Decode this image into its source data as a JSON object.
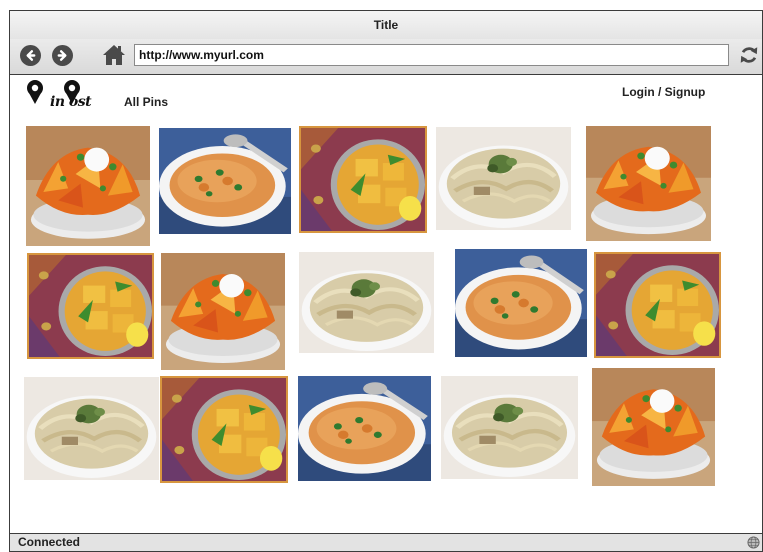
{
  "window": {
    "title": "Title"
  },
  "toolbar": {
    "url": "http://www.myurl.com",
    "back_icon": "arrow-left-circle-icon",
    "forward_icon": "arrow-right-circle-icon",
    "home_icon": "home-icon",
    "reload_icon": "refresh-icon"
  },
  "header": {
    "logo_text": "in ost",
    "all_pins": "All Pins",
    "login": "Login / Signup"
  },
  "pins": [
    {
      "dish": "curry-nachos",
      "framed": false
    },
    {
      "dish": "soup-bowl",
      "framed": false
    },
    {
      "dish": "tofu-curry",
      "framed": true
    },
    {
      "dish": "pasta",
      "framed": false
    },
    {
      "dish": "curry-nachos",
      "framed": false
    },
    {
      "dish": "tofu-curry",
      "framed": true
    },
    {
      "dish": "curry-nachos",
      "framed": false
    },
    {
      "dish": "pasta",
      "framed": false
    },
    {
      "dish": "soup-bowl",
      "framed": false
    },
    {
      "dish": "tofu-curry",
      "framed": true
    },
    {
      "dish": "pasta",
      "framed": false
    },
    {
      "dish": "tofu-curry",
      "framed": true
    },
    {
      "dish": "soup-bowl",
      "framed": false
    },
    {
      "dish": "pasta",
      "framed": false
    },
    {
      "dish": "curry-nachos",
      "framed": false
    }
  ],
  "status": {
    "text": "Connected",
    "icon": "globe-icon"
  },
  "colors": {
    "pin_frame": "#d7963f",
    "chrome": "#e3e3e3",
    "border": "#3c3c3c"
  }
}
